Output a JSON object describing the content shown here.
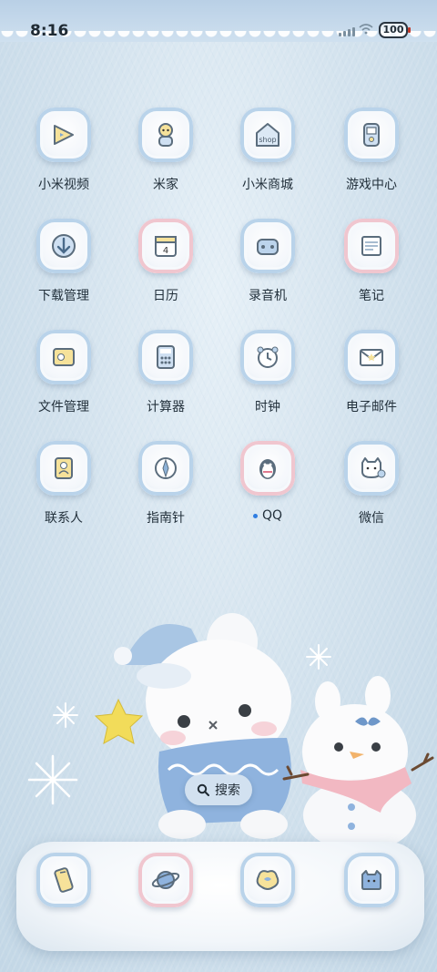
{
  "status_bar": {
    "time": "8:16",
    "battery": "100"
  },
  "apps": [
    {
      "label": "小米视频",
      "icon": "video-icon",
      "frame": "blue"
    },
    {
      "label": "米家",
      "icon": "home-robot-icon",
      "frame": "blue"
    },
    {
      "label": "小米商城",
      "icon": "shop-icon",
      "frame": "blue"
    },
    {
      "label": "游戏中心",
      "icon": "gamepad-icon",
      "frame": "blue"
    },
    {
      "label": "下载管理",
      "icon": "download-icon",
      "frame": "blue"
    },
    {
      "label": "日历",
      "icon": "calendar-icon",
      "frame": "pink",
      "badge": "4"
    },
    {
      "label": "录音机",
      "icon": "recorder-icon",
      "frame": "blue"
    },
    {
      "label": "笔记",
      "icon": "notes-icon",
      "frame": "pink"
    },
    {
      "label": "文件管理",
      "icon": "file-manager-icon",
      "frame": "blue"
    },
    {
      "label": "计算器",
      "icon": "calculator-icon",
      "frame": "blue"
    },
    {
      "label": "时钟",
      "icon": "clock-icon",
      "frame": "blue"
    },
    {
      "label": "电子邮件",
      "icon": "mail-icon",
      "frame": "blue"
    },
    {
      "label": "联系人",
      "icon": "contacts-icon",
      "frame": "blue"
    },
    {
      "label": "指南针",
      "icon": "compass-icon",
      "frame": "blue"
    },
    {
      "label": "QQ",
      "icon": "penguin-icon",
      "frame": "pink",
      "new_dot": true
    },
    {
      "label": "微信",
      "icon": "cat-chat-icon",
      "frame": "blue"
    }
  ],
  "search": {
    "label": "搜索"
  },
  "dock": [
    {
      "icon": "phone-icon",
      "frame": "blue"
    },
    {
      "icon": "planet-browser-icon",
      "frame": "pink"
    },
    {
      "icon": "gallery-icon",
      "frame": "blue"
    },
    {
      "icon": "camera-icon",
      "frame": "blue"
    }
  ]
}
